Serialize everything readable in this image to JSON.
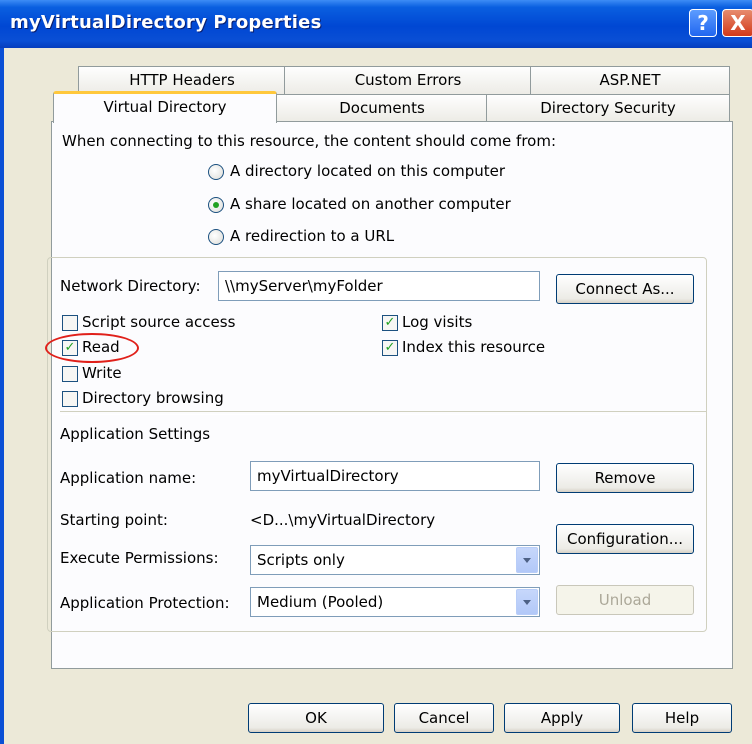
{
  "window": {
    "title": "myVirtualDirectory Properties",
    "help_glyph": "?",
    "close_glyph": "X"
  },
  "tabs": {
    "row_back": [
      "HTTP Headers",
      "Custom Errors",
      "ASP.NET"
    ],
    "row_front": [
      "Virtual Directory",
      "Documents",
      "Directory Security"
    ],
    "active": "Virtual Directory"
  },
  "content_source": {
    "prompt": "When connecting to this resource, the content should come from:",
    "options": [
      "A directory located on this computer",
      "A share located on another computer",
      "A redirection to a URL"
    ],
    "selected": "A share located on another computer"
  },
  "network": {
    "label": "Network Directory:",
    "value": "\\\\myServer\\myFolder",
    "connect_button": "Connect As..."
  },
  "permissions": {
    "script_source_access": {
      "label": "Script source access",
      "checked": false
    },
    "read": {
      "label": "Read",
      "checked": true
    },
    "write": {
      "label": "Write",
      "checked": false
    },
    "directory_browsing": {
      "label": "Directory browsing",
      "checked": false
    },
    "log_visits": {
      "label": "Log visits",
      "checked": true
    },
    "index_resource": {
      "label": "Index this resource",
      "checked": true
    }
  },
  "app_settings": {
    "heading": "Application Settings",
    "name_label": "Application name:",
    "name_value": "myVirtualDirectory",
    "starting_label": "Starting point:",
    "starting_value": "<D...\\myVirtualDirectory",
    "exec_label": "Execute Permissions:",
    "exec_value": "Scripts only",
    "protection_label": "Application Protection:",
    "protection_value": "Medium (Pooled)",
    "remove_button": "Remove",
    "config_button": "Configuration...",
    "unload_button": "Unload"
  },
  "footer": {
    "ok": "OK",
    "cancel": "Cancel",
    "apply": "Apply",
    "help": "Help"
  },
  "colors": {
    "titlebar": "#0047d3",
    "dialog_bg": "#ece9d8",
    "tab_highlight": "#ffc83c",
    "check_green": "#21a121",
    "annotation_red": "#e0201a"
  },
  "checkmark_glyph": "✓"
}
